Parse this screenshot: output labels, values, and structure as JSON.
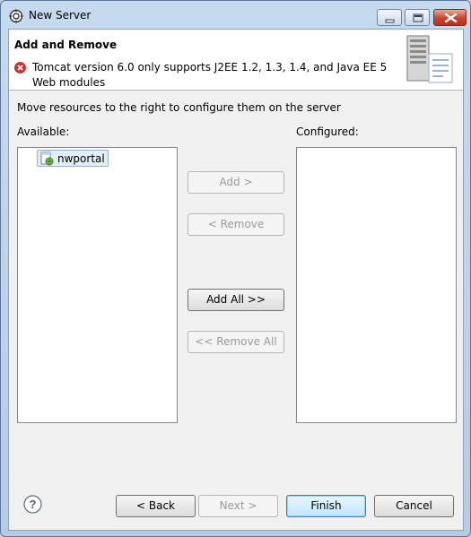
{
  "window": {
    "title": "New Server"
  },
  "titlebar_icons": [
    "eclipse-gear-icon",
    "minimize-icon",
    "maximize-icon",
    "close-icon"
  ],
  "header": {
    "title": "Add and Remove",
    "message": "Tomcat version 6.0 only supports J2EE 1.2, 1.3, 1.4, and Java EE 5 Web modules",
    "message_icon": "error-icon",
    "art_icon": "server-icon"
  },
  "body": {
    "instruction": "Move resources to the right to configure them on the server",
    "available_label": "Available:",
    "configured_label": "Configured:",
    "available_items": [
      {
        "label": "nwportal",
        "icon": "web-project-icon",
        "selected": true
      }
    ],
    "configured_items": []
  },
  "transfer": {
    "add": "Add >",
    "remove": "< Remove",
    "add_all": "Add All >>",
    "remove_all": "<< Remove All"
  },
  "footer": {
    "help_icon": "help-icon",
    "back": "< Back",
    "next": "Next >",
    "finish": "Finish",
    "cancel": "Cancel"
  },
  "colors": {
    "error": "#d9342b",
    "default_button_border": "#3c7fb1",
    "close_button": "#c8432d"
  }
}
